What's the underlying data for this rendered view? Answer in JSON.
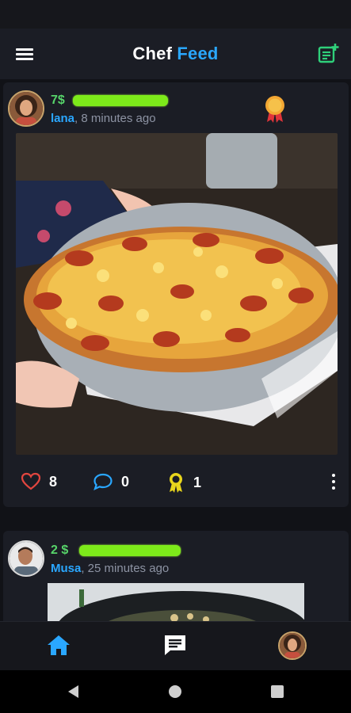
{
  "app": {
    "title_part1": "Chef",
    "title_part2": "Feed"
  },
  "icons": {
    "menu": "menu-icon",
    "new_post": "new-post-icon",
    "medal": "medal-icon",
    "like": "heart-icon",
    "comment": "comment-icon",
    "award": "award-icon",
    "more": "more-vertical-icon",
    "home": "home-icon",
    "chat": "chat-icon",
    "back": "back-triangle-icon",
    "home_sys": "home-circle-icon",
    "recents": "recents-square-icon"
  },
  "colors": {
    "accent_blue": "#2aa7ff",
    "price_green": "#57d46a",
    "like_red": "#e2463f",
    "award_yellow": "#e8d51c",
    "background": "#111217",
    "card": "#1b1d25"
  },
  "posts": [
    {
      "price": "7$",
      "author": "lana",
      "time": ", 8 minutes ago",
      "likes": "8",
      "comments": "0",
      "awards": "1"
    },
    {
      "price": "2 $",
      "author": "Musa",
      "time": ", 25 minutes ago"
    }
  ]
}
